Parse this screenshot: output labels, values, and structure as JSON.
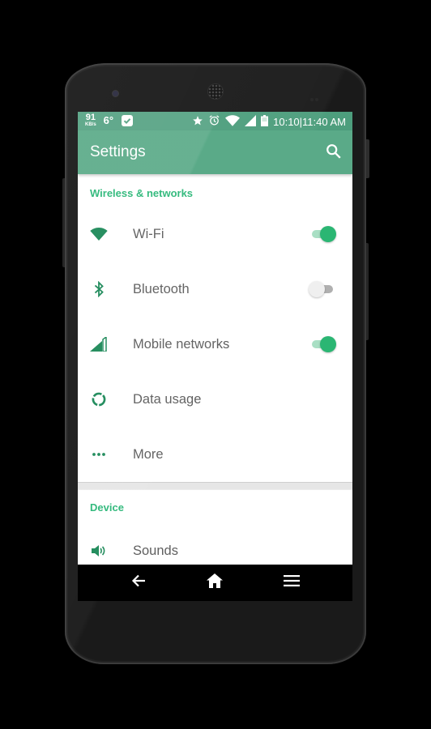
{
  "statusbar": {
    "net_speed_value": "91",
    "net_speed_unit": "KB/s",
    "temperature": "6°",
    "icons": [
      "check-badge-icon",
      "star-icon",
      "alarm-icon",
      "wifi-signal-icon",
      "cell-signal-icon",
      "battery-icon"
    ],
    "clock": "10:10|11:40 AM"
  },
  "appbar": {
    "title": "Settings",
    "search_icon": "search-icon"
  },
  "sections": [
    {
      "header": "Wireless & networks",
      "items": [
        {
          "label": "Wi-Fi",
          "icon": "wifi-icon",
          "toggle": true
        },
        {
          "label": "Bluetooth",
          "icon": "bluetooth-icon",
          "toggle": false
        },
        {
          "label": "Mobile networks",
          "icon": "cell-signal-icon",
          "toggle": true
        },
        {
          "label": "Data usage",
          "icon": "data-usage-icon"
        },
        {
          "label": "More",
          "icon": "more-dots-icon"
        }
      ]
    },
    {
      "header": "Device",
      "items": [
        {
          "label": "Sounds",
          "icon": "volume-icon"
        }
      ]
    }
  ],
  "navbar": {
    "back": "back-icon",
    "home": "home-icon",
    "menu": "menu-icon"
  },
  "colors": {
    "primary": "#5aaa88",
    "status_bar": "#4d9e7d",
    "accent": "#2bb673",
    "section_header": "#2eb87a",
    "icon": "#1e8a5a"
  }
}
